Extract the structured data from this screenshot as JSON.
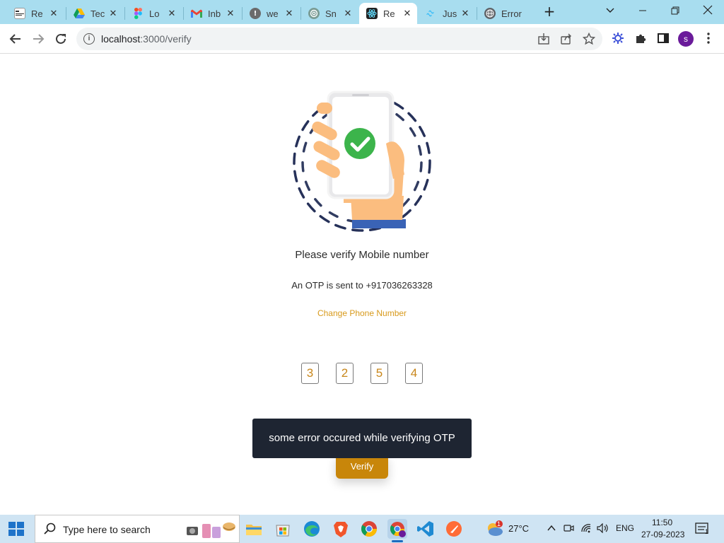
{
  "browser": {
    "tabs": [
      {
        "title": "Re",
        "favicon": "news-favicon"
      },
      {
        "title": "Tec",
        "favicon": "drive-favicon"
      },
      {
        "title": "Lo",
        "favicon": "figma-favicon"
      },
      {
        "title": "Inb",
        "favicon": "gmail-favicon"
      },
      {
        "title": "we",
        "favicon": "alert-favicon"
      },
      {
        "title": "Sn",
        "favicon": "chatgpt-favicon"
      },
      {
        "title": "Re",
        "favicon": "react-favicon",
        "active": true
      },
      {
        "title": "Jus",
        "favicon": "tailwind-favicon"
      },
      {
        "title": "Error",
        "favicon": "globe-favicon"
      }
    ],
    "close_glyph": "✕",
    "new_tab_glyph": "+",
    "url_host": "localhost",
    "url_path": ":3000/verify"
  },
  "profile": {
    "initial": "s",
    "color": "#6a1b9a"
  },
  "page": {
    "title": "Please verify Mobile number",
    "otp_sent_text": "An OTP is sent to +917036263328",
    "change_phone_label": "Change Phone Number",
    "otp_digits": [
      "3",
      "2",
      "5",
      "4"
    ],
    "verify_label": "Verify",
    "toast_message": "some error occured while verifying OTP"
  },
  "colors": {
    "accent": "#c8860a",
    "link": "#d89a1c",
    "toast_bg": "#1e2532",
    "tabstrip_bg": "#a8ddef"
  },
  "taskbar": {
    "search_placeholder": "Type here to search",
    "weather_temp": "27°C",
    "weather_badge": "1",
    "language": "ENG",
    "time": "11:50",
    "date": "27-09-2023",
    "notification_count": "1"
  }
}
